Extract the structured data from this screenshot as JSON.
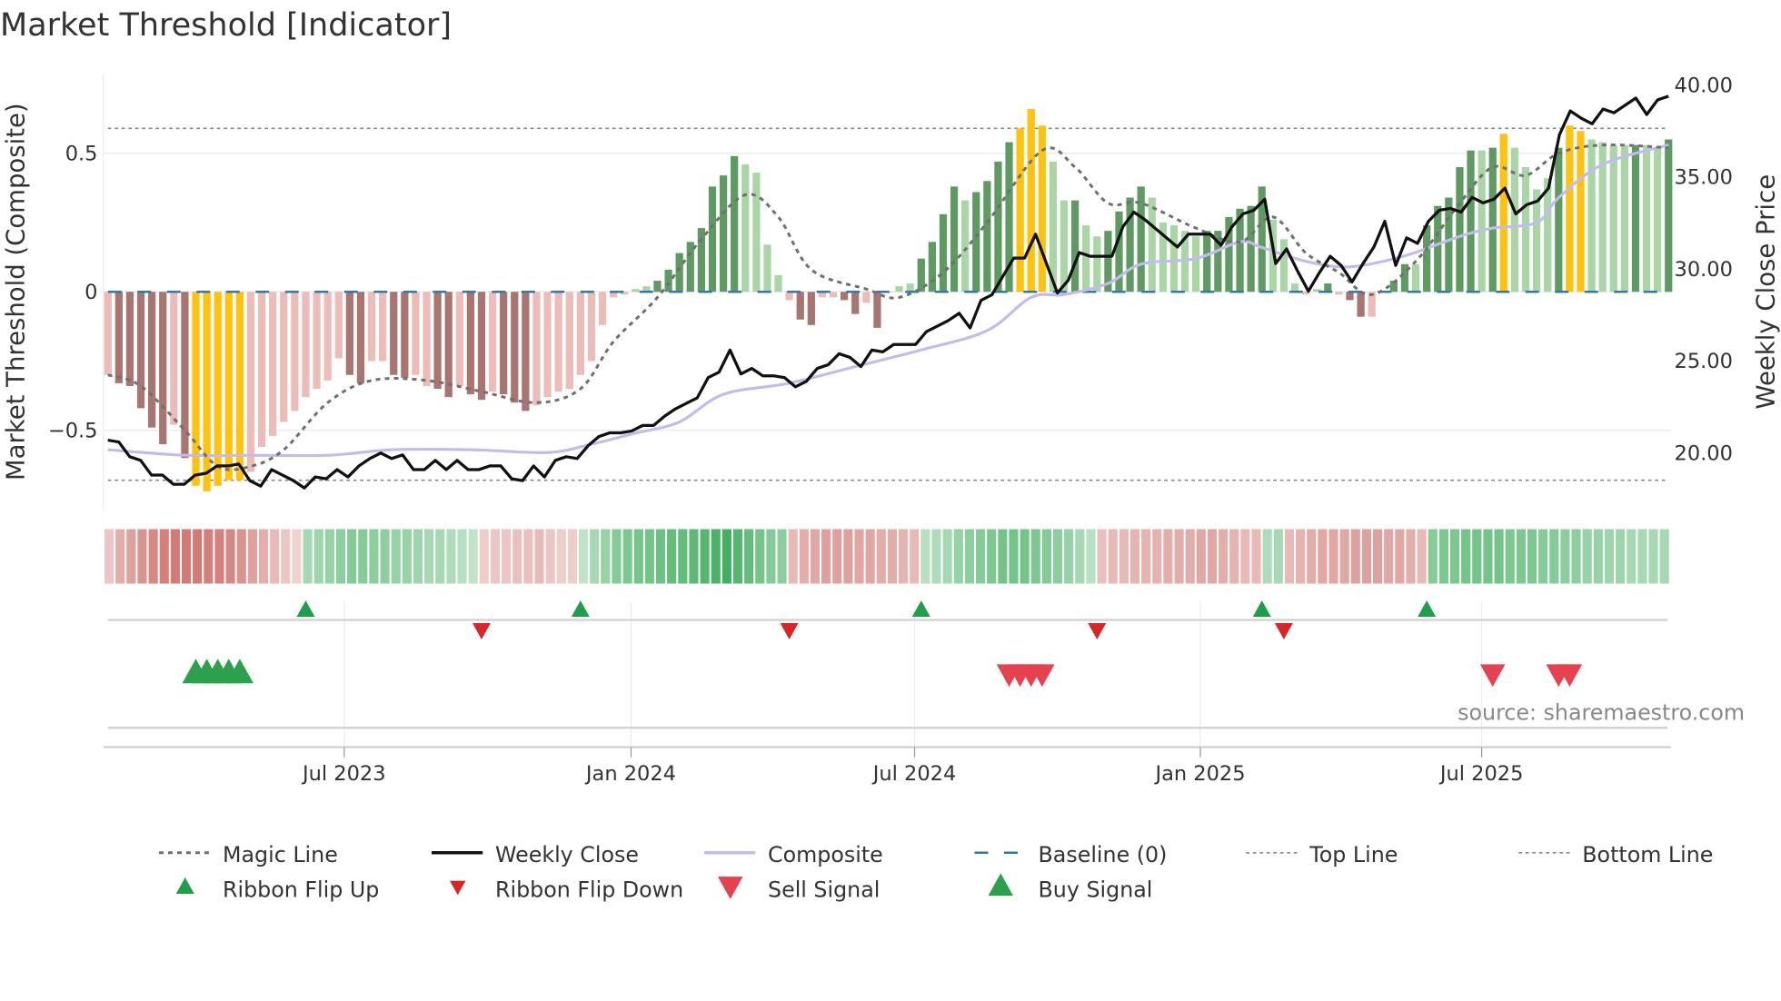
{
  "chart_data": {
    "type": "bar",
    "title": "Market Threshold [Indicator]",
    "ylabel_left": "Market Threshold (Composite)",
    "ylabel_right": "Weekly Close Price",
    "left_ticks": [
      {
        "v": 0.5,
        "label": "0.5"
      },
      {
        "v": 0,
        "label": "0"
      },
      {
        "v": -0.5,
        "label": "−0.5"
      }
    ],
    "right_ticks": [
      {
        "v": 40,
        "label": "40.00"
      },
      {
        "v": 35,
        "label": "35.00"
      },
      {
        "v": 30,
        "label": "30.00"
      },
      {
        "v": 25,
        "label": "25.00"
      },
      {
        "v": 20,
        "label": "20.00"
      }
    ],
    "ylim_left": [
      -0.78,
      0.78
    ],
    "ylim_right": [
      16,
      41
    ],
    "top_line": 0.59,
    "bottom_line": -0.68,
    "x_ticks": [
      {
        "week": 21.5,
        "label": "Jul 2023"
      },
      {
        "week": 47.6,
        "label": "Jan 2024"
      },
      {
        "week": 73.4,
        "label": "Jul 2024"
      },
      {
        "week": 99.4,
        "label": "Jan 2025"
      },
      {
        "week": 125.0,
        "label": "Jul 2025"
      }
    ],
    "bar_colors": {
      "dr": "#a97571",
      "lr": "#ecbcb8",
      "dg": "#5f9a63",
      "lg": "#aad6a6",
      "y": "#ffc20e"
    },
    "bars": [
      [
        -0.3,
        "lr"
      ],
      [
        -0.33,
        "dr"
      ],
      [
        -0.34,
        "dr"
      ],
      [
        -0.42,
        "dr"
      ],
      [
        -0.49,
        "dr"
      ],
      [
        -0.55,
        "dr"
      ],
      [
        -0.48,
        "lr"
      ],
      [
        -0.6,
        "dr"
      ],
      [
        -0.7,
        "y"
      ],
      [
        -0.72,
        "y"
      ],
      [
        -0.7,
        "y"
      ],
      [
        -0.68,
        "y"
      ],
      [
        -0.68,
        "y"
      ],
      [
        -0.65,
        "lr"
      ],
      [
        -0.56,
        "lr"
      ],
      [
        -0.52,
        "lr"
      ],
      [
        -0.47,
        "lr"
      ],
      [
        -0.43,
        "lr"
      ],
      [
        -0.38,
        "lr"
      ],
      [
        -0.35,
        "lr"
      ],
      [
        -0.32,
        "lr"
      ],
      [
        -0.24,
        "lr"
      ],
      [
        -0.3,
        "dr"
      ],
      [
        -0.33,
        "dr"
      ],
      [
        -0.25,
        "lr"
      ],
      [
        -0.25,
        "lr"
      ],
      [
        -0.3,
        "dr"
      ],
      [
        -0.31,
        "dr"
      ],
      [
        -0.3,
        "lr"
      ],
      [
        -0.34,
        "lr"
      ],
      [
        -0.35,
        "dr"
      ],
      [
        -0.38,
        "dr"
      ],
      [
        -0.34,
        "lr"
      ],
      [
        -0.37,
        "dr"
      ],
      [
        -0.39,
        "dr"
      ],
      [
        -0.36,
        "lr"
      ],
      [
        -0.37,
        "dr"
      ],
      [
        -0.4,
        "dr"
      ],
      [
        -0.43,
        "dr"
      ],
      [
        -0.41,
        "lr"
      ],
      [
        -0.38,
        "lr"
      ],
      [
        -0.36,
        "lr"
      ],
      [
        -0.35,
        "lr"
      ],
      [
        -0.3,
        "lr"
      ],
      [
        -0.25,
        "lr"
      ],
      [
        -0.12,
        "lr"
      ],
      [
        -0.02,
        "lr"
      ],
      [
        -0.01,
        "lr"
      ],
      [
        0.01,
        "lg"
      ],
      [
        0.02,
        "lg"
      ],
      [
        0.04,
        "dg"
      ],
      [
        0.08,
        "dg"
      ],
      [
        0.14,
        "dg"
      ],
      [
        0.18,
        "dg"
      ],
      [
        0.23,
        "dg"
      ],
      [
        0.38,
        "dg"
      ],
      [
        0.42,
        "dg"
      ],
      [
        0.49,
        "dg"
      ],
      [
        0.46,
        "lg"
      ],
      [
        0.43,
        "lg"
      ],
      [
        0.17,
        "lg"
      ],
      [
        0.06,
        "lg"
      ],
      [
        -0.03,
        "lr"
      ],
      [
        -0.1,
        "dr"
      ],
      [
        -0.12,
        "dr"
      ],
      [
        -0.02,
        "lr"
      ],
      [
        -0.02,
        "lr"
      ],
      [
        -0.03,
        "dr"
      ],
      [
        -0.08,
        "dr"
      ],
      [
        -0.04,
        "lr"
      ],
      [
        -0.13,
        "dr"
      ],
      [
        0.0,
        "lg"
      ],
      [
        0.02,
        "lg"
      ],
      [
        0.03,
        "lg"
      ],
      [
        0.12,
        "dg"
      ],
      [
        0.18,
        "dg"
      ],
      [
        0.28,
        "dg"
      ],
      [
        0.38,
        "dg"
      ],
      [
        0.33,
        "lg"
      ],
      [
        0.36,
        "dg"
      ],
      [
        0.4,
        "dg"
      ],
      [
        0.47,
        "dg"
      ],
      [
        0.54,
        "dg"
      ],
      [
        0.59,
        "y"
      ],
      [
        0.66,
        "y"
      ],
      [
        0.6,
        "y"
      ],
      [
        0.47,
        "lg"
      ],
      [
        0.33,
        "lg"
      ],
      [
        0.33,
        "dg"
      ],
      [
        0.24,
        "lg"
      ],
      [
        0.2,
        "lg"
      ],
      [
        0.22,
        "dg"
      ],
      [
        0.29,
        "dg"
      ],
      [
        0.34,
        "dg"
      ],
      [
        0.38,
        "dg"
      ],
      [
        0.34,
        "lg"
      ],
      [
        0.25,
        "lg"
      ],
      [
        0.24,
        "lg"
      ],
      [
        0.22,
        "lg"
      ],
      [
        0.2,
        "lg"
      ],
      [
        0.22,
        "dg"
      ],
      [
        0.22,
        "dg"
      ],
      [
        0.27,
        "dg"
      ],
      [
        0.3,
        "dg"
      ],
      [
        0.31,
        "dg"
      ],
      [
        0.38,
        "dg"
      ],
      [
        0.26,
        "lg"
      ],
      [
        0.19,
        "lg"
      ],
      [
        0.03,
        "lg"
      ],
      [
        -0.01,
        "lr"
      ],
      [
        0.01,
        "lg"
      ],
      [
        0.03,
        "dg"
      ],
      [
        -0.01,
        "lr"
      ],
      [
        -0.03,
        "dr"
      ],
      [
        -0.09,
        "dr"
      ],
      [
        -0.09,
        "lr"
      ],
      [
        0.0,
        "lg"
      ],
      [
        0.04,
        "dg"
      ],
      [
        0.1,
        "dg"
      ],
      [
        0.1,
        "lg"
      ],
      [
        0.24,
        "dg"
      ],
      [
        0.31,
        "dg"
      ],
      [
        0.34,
        "dg"
      ],
      [
        0.45,
        "dg"
      ],
      [
        0.51,
        "dg"
      ],
      [
        0.51,
        "lg"
      ],
      [
        0.52,
        "dg"
      ],
      [
        0.57,
        "y"
      ],
      [
        0.52,
        "lg"
      ],
      [
        0.45,
        "lg"
      ],
      [
        0.37,
        "lg"
      ],
      [
        0.41,
        "lg"
      ],
      [
        0.52,
        "dg"
      ],
      [
        0.6,
        "y"
      ],
      [
        0.58,
        "y"
      ],
      [
        0.55,
        "lg"
      ],
      [
        0.54,
        "lg"
      ],
      [
        0.53,
        "lg"
      ],
      [
        0.53,
        "lg"
      ],
      [
        0.53,
        "dg"
      ],
      [
        0.53,
        "lg"
      ],
      [
        0.52,
        "lg"
      ],
      [
        0.55,
        "dg"
      ]
    ],
    "weekly_close": [
      20.7,
      20.6,
      19.8,
      19.6,
      18.8,
      18.8,
      18.3,
      18.3,
      18.8,
      18.9,
      19.3,
      19.3,
      19.4,
      18.5,
      18.2,
      19.1,
      18.8,
      18.5,
      18.1,
      18.7,
      18.6,
      19.1,
      18.7,
      19.3,
      19.7,
      20.0,
      19.7,
      19.9,
      19.1,
      19.1,
      19.6,
      19.1,
      19.6,
      19.1,
      19.1,
      19.3,
      19.3,
      18.6,
      18.5,
      19.3,
      18.7,
      19.6,
      19.8,
      19.7,
      20.4,
      20.9,
      21.1,
      21.1,
      21.2,
      21.5,
      21.5,
      22.0,
      22.4,
      22.7,
      23.0,
      24.1,
      24.4,
      25.6,
      24.3,
      24.6,
      24.2,
      24.2,
      24.1,
      23.6,
      23.9,
      24.6,
      24.8,
      25.4,
      25.2,
      24.7,
      25.6,
      25.5,
      25.9,
      25.9,
      25.9,
      26.6,
      26.9,
      27.2,
      27.6,
      26.8,
      28.3,
      28.6,
      29.6,
      30.6,
      30.6,
      31.9,
      30.3,
      28.7,
      29.4,
      30.9,
      30.7,
      30.7,
      30.7,
      32.3,
      33.1,
      32.7,
      32.2,
      31.7,
      31.2,
      31.9,
      31.9,
      31.9,
      31.3,
      32.3,
      33.0,
      33.2,
      33.8,
      30.3,
      31.1,
      29.9,
      28.8,
      29.8,
      30.7,
      30.2,
      29.3,
      30.3,
      31.2,
      32.6,
      30.2,
      31.7,
      31.4,
      32.6,
      33.2,
      33.3,
      33.1,
      33.9,
      33.6,
      33.8,
      34.4,
      33.0,
      33.5,
      33.7,
      34.4,
      37.3,
      38.6,
      38.2,
      37.9,
      38.7,
      38.5,
      38.9,
      39.3,
      38.4,
      39.2,
      39.4
    ],
    "composite": [
      [
        0,
        -0.57
      ],
      [
        7,
        -0.59
      ],
      [
        13,
        -0.59
      ],
      [
        20,
        -0.59
      ],
      [
        26,
        -0.57
      ],
      [
        33,
        -0.57
      ],
      [
        40,
        -0.58
      ],
      [
        44,
        -0.55
      ],
      [
        48,
        -0.51
      ],
      [
        52,
        -0.47
      ],
      [
        56,
        -0.37
      ],
      [
        62,
        -0.33
      ],
      [
        68,
        -0.27
      ],
      [
        74,
        -0.21
      ],
      [
        80,
        -0.14
      ],
      [
        84,
        -0.02
      ],
      [
        87,
        -0.01
      ],
      [
        91,
        0.03
      ],
      [
        94,
        0.1
      ],
      [
        99,
        0.12
      ],
      [
        103,
        0.18
      ],
      [
        105,
        0.16
      ],
      [
        109,
        0.11
      ],
      [
        113,
        0.09
      ],
      [
        118,
        0.13
      ],
      [
        123,
        0.2
      ],
      [
        126,
        0.23
      ],
      [
        130,
        0.25
      ],
      [
        132,
        0.34
      ],
      [
        136,
        0.46
      ],
      [
        142,
        0.53
      ]
    ],
    "magic_line": [
      [
        0,
        -0.3
      ],
      [
        3,
        -0.34
      ],
      [
        7,
        -0.5
      ],
      [
        10,
        -0.63
      ],
      [
        13,
        -0.63
      ],
      [
        16,
        -0.57
      ],
      [
        20,
        -0.4
      ],
      [
        24,
        -0.32
      ],
      [
        29,
        -0.32
      ],
      [
        34,
        -0.36
      ],
      [
        39,
        -0.4
      ],
      [
        43,
        -0.35
      ],
      [
        46,
        -0.18
      ],
      [
        50,
        -0.02
      ],
      [
        54,
        0.19
      ],
      [
        58,
        0.35
      ],
      [
        61,
        0.27
      ],
      [
        64,
        0.08
      ],
      [
        69,
        0.01
      ],
      [
        72,
        -0.02
      ],
      [
        76,
        0.07
      ],
      [
        80,
        0.25
      ],
      [
        85,
        0.51
      ],
      [
        88,
        0.45
      ],
      [
        91,
        0.32
      ],
      [
        94,
        0.32
      ],
      [
        99,
        0.23
      ],
      [
        103,
        0.18
      ],
      [
        106,
        0.27
      ],
      [
        109,
        0.14
      ],
      [
        112,
        0.07
      ],
      [
        115,
        -0.01
      ],
      [
        119,
        0.11
      ],
      [
        123,
        0.32
      ],
      [
        126,
        0.45
      ],
      [
        129,
        0.42
      ],
      [
        132,
        0.5
      ],
      [
        136,
        0.53
      ],
      [
        142,
        0.52
      ]
    ],
    "ribbon": [
      -0.2,
      -0.4,
      -0.5,
      -0.6,
      -0.7,
      -0.75,
      -0.8,
      -0.8,
      -0.8,
      -0.75,
      -0.75,
      -0.7,
      -0.6,
      -0.5,
      -0.4,
      -0.3,
      -0.2,
      -0.1,
      0.3,
      0.35,
      0.4,
      0.45,
      0.5,
      0.5,
      0.45,
      0.45,
      0.4,
      0.4,
      0.35,
      0.3,
      0.3,
      0.25,
      0.2,
      0.15,
      -0.15,
      -0.2,
      -0.2,
      -0.25,
      -0.25,
      -0.3,
      -0.2,
      -0.15,
      -0.15,
      0.15,
      0.3,
      0.4,
      0.5,
      0.55,
      0.6,
      0.6,
      0.65,
      0.7,
      0.7,
      0.75,
      0.8,
      0.85,
      0.9,
      0.8,
      0.7,
      0.6,
      0.5,
      0.45,
      -0.3,
      -0.4,
      -0.45,
      -0.5,
      -0.5,
      -0.5,
      -0.45,
      -0.45,
      -0.4,
      -0.4,
      -0.35,
      -0.3,
      0.2,
      0.25,
      0.3,
      0.4,
      0.45,
      0.5,
      0.55,
      0.6,
      0.6,
      0.6,
      0.55,
      0.5,
      0.45,
      0.4,
      0.3,
      0.2,
      -0.25,
      -0.3,
      -0.3,
      -0.35,
      -0.35,
      -0.35,
      -0.4,
      -0.4,
      -0.4,
      -0.45,
      -0.45,
      -0.4,
      -0.35,
      -0.3,
      -0.3,
      0.25,
      0.3,
      -0.3,
      -0.35,
      -0.4,
      -0.45,
      -0.45,
      -0.45,
      -0.5,
      -0.5,
      -0.5,
      -0.45,
      -0.45,
      -0.4,
      -0.3,
      0.5,
      0.55,
      0.55,
      0.6,
      0.6,
      0.6,
      0.6,
      0.55,
      0.55,
      0.55,
      0.5,
      0.5,
      0.45,
      0.45,
      0.4,
      0.4,
      0.35,
      0.35,
      0.3,
      0.3,
      0.3,
      0.3
    ],
    "ribbon_colors": {
      "positive": "#34a853",
      "negative": "#c9625c"
    },
    "signals": {
      "ribbon_flip_up": [
        18,
        43,
        74,
        105,
        120
      ],
      "ribbon_flip_down": [
        34,
        62,
        90,
        107
      ],
      "buy": [
        8,
        9,
        10,
        11,
        12
      ],
      "sell": [
        82,
        83,
        84,
        85,
        126,
        132,
        133
      ]
    },
    "legend": [
      {
        "label": "Magic Line",
        "kind": "magic"
      },
      {
        "label": "Weekly Close",
        "kind": "close"
      },
      {
        "label": "Composite",
        "kind": "composite"
      },
      {
        "label": "Baseline (0)",
        "kind": "baseline"
      },
      {
        "label": "Top Line",
        "kind": "top"
      },
      {
        "label": "Bottom Line",
        "kind": "bottom"
      },
      {
        "label": "Ribbon Flip Up",
        "kind": "flipup"
      },
      {
        "label": "Ribbon Flip Down",
        "kind": "flipdown"
      },
      {
        "label": "Sell Signal",
        "kind": "sell"
      },
      {
        "label": "Buy Signal",
        "kind": "buy"
      }
    ],
    "source": "source: sharemaestro.com"
  }
}
